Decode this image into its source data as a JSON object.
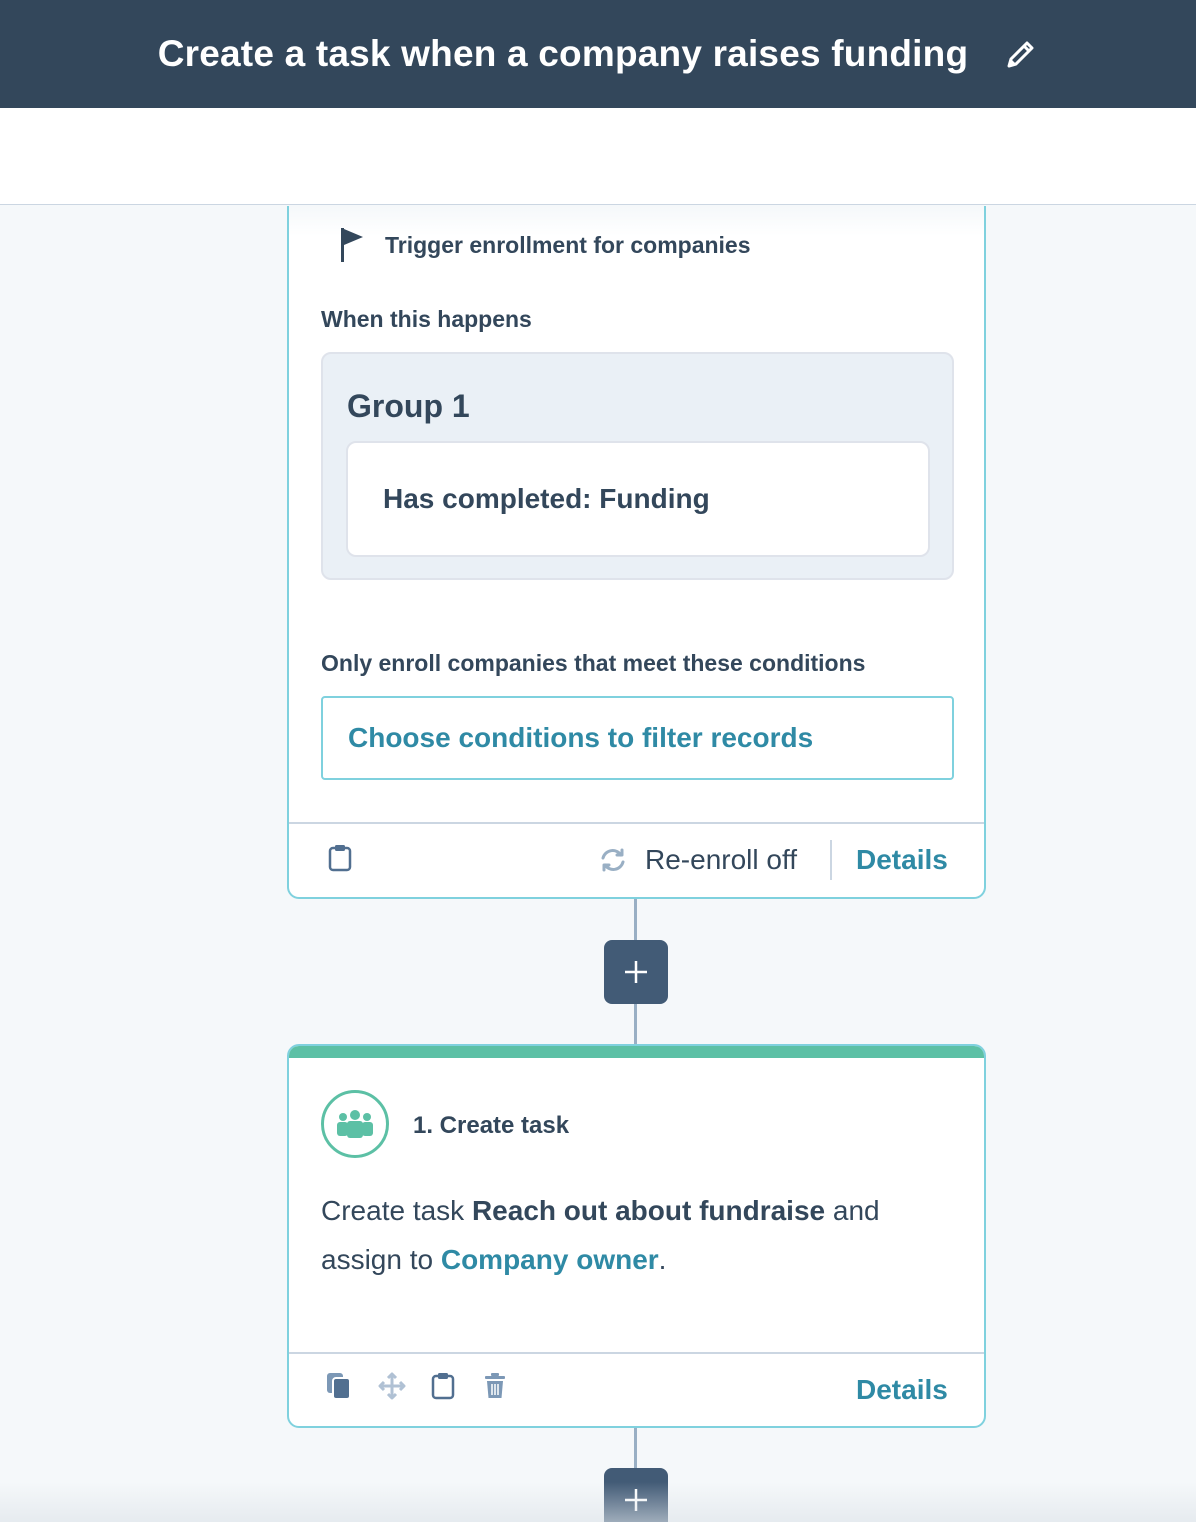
{
  "header": {
    "title": "Create a task when a company raises funding",
    "edit_icon": "pencil-icon"
  },
  "trigger": {
    "heading": "Trigger enrollment for companies",
    "flag_icon": "flag-icon",
    "when_label": "When this happens",
    "group": {
      "title": "Group 1",
      "criteria": "Has completed: Funding"
    },
    "only_label": "Only enroll companies that meet these conditions",
    "filter_button": "Choose conditions to filter records",
    "footer": {
      "clipboard_icon": "clipboard-icon",
      "reenroll_icon": "refresh-icon",
      "reenroll_label": "Re-enroll off",
      "details_label": "Details"
    }
  },
  "action": {
    "icon": "people-icon",
    "title": "1. Create task",
    "body": {
      "prefix": "Create task ",
      "task_name": "Reach out about fundraise",
      "middle": " and assign to ",
      "assignee": "Company owner",
      "suffix": "."
    },
    "footer": {
      "icons": [
        "copy-icon",
        "move-icon",
        "clipboard-icon",
        "trash-icon"
      ],
      "details_label": "Details"
    }
  },
  "colors": {
    "header_bg": "#33475b",
    "link": "#2f8aa5",
    "card_border": "#7fd1de",
    "accent": "#5cc0a5",
    "plus_button": "#425b76"
  }
}
